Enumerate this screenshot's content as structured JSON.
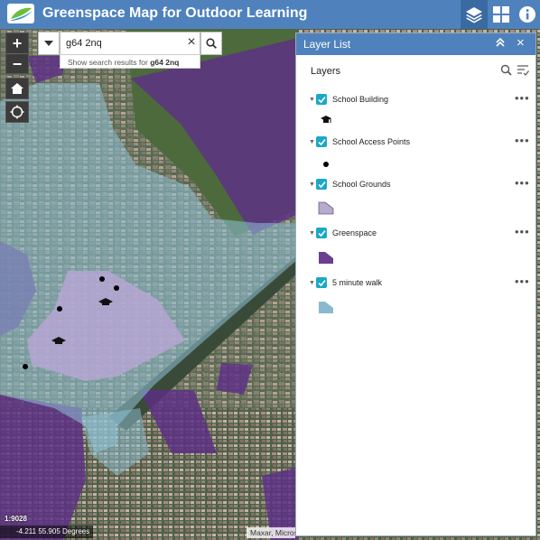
{
  "app": {
    "title": "Greenspace Map for Outdoor Learning"
  },
  "search": {
    "value": "g64 2nq",
    "suggestion_prefix": "Show search results for",
    "suggestion_term": "g64 2nq"
  },
  "layer_list": {
    "title": "Layer List",
    "heading": "Layers",
    "layers": [
      {
        "label": "School Building",
        "symbol": "graduation-cap-icon"
      },
      {
        "label": "School Access Points",
        "symbol": "black-dot-icon"
      },
      {
        "label": "School Grounds",
        "symbol": "polygon-lavender",
        "color": "#b7aacd"
      },
      {
        "label": "Greenspace",
        "symbol": "polygon-purple",
        "color": "#6a3f8f"
      },
      {
        "label": "5 minute walk",
        "symbol": "polygon-lightblue",
        "color": "#8ab9cf"
      }
    ]
  },
  "map": {
    "scale": "1:9028",
    "coordinates": "-4.211 55.905 Degrees",
    "attribution": "Maxar, Microsoft"
  },
  "colors": {
    "header": "#4f82bd",
    "checkbox": "#1aa8c7",
    "greenspace": "#6a3f8f",
    "walk_zone": "#8ab9cf",
    "school_grounds": "#b7aacd"
  }
}
